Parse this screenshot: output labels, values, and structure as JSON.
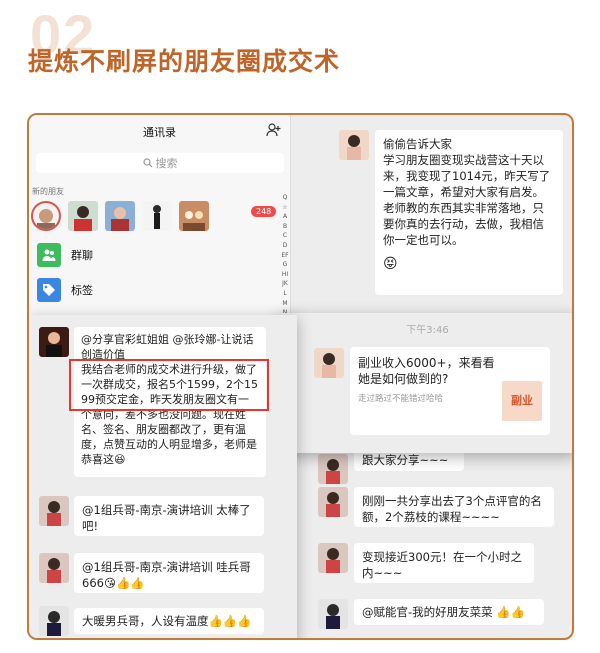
{
  "header": {
    "bg_number": "02",
    "title": "提炼不刷屏的朋友圈成交术"
  },
  "contacts": {
    "title": "通讯录",
    "search_placeholder": "搜索",
    "new_friends_label": "新的朋友",
    "new_friends_badge": "248",
    "menu": [
      {
        "label": "群聊",
        "color": "#3dbb5d"
      },
      {
        "label": "标签",
        "color": "#3b86e0"
      }
    ],
    "index_letters": "Q☆ABCDEFGHIJKLMNOPQRSTUVWXYZ#"
  },
  "chat_right": {
    "messages": [
      {
        "text": "偷偷告诉大家\n学习朋友圈变现实战营这十天以来，我变现了1014元，昨天写了一篇文章，希望对大家有启发。\n老师教的东西其实非常落地，只要你真的去行动，去做，我相信你一定也可以。",
        "emoji": "😝"
      },
      {
        "text": "跟大家分享~~~"
      },
      {
        "text": "刚刚一共分享出去了3个点评官的名额，2个荔枝的课程~~~~"
      },
      {
        "text": "变现接近300元！在一个小时之内~~~"
      },
      {
        "text": "@赋能官-我的好朋友菜菜",
        "emoji": "👍👍"
      }
    ],
    "time": "下午3:46",
    "link_card": {
      "title": "副业收入6000+，来看看她是如何做到的?",
      "source": "走过路过不能错过哈哈",
      "thumb_text": "副业"
    }
  },
  "group_chat": {
    "messages": [
      {
        "text": "@分享官彩虹姐姐 @张玲娜-让说话创造价值\n我结合老师的成交术进行升级，做了一次群成交，报名5个1599，2个1599预交定金，昨天发朋友圈文有一个意向，差不多也没问题。现在姓名、签名、朋友圈都改了，更有温度，点赞互动的人明显增多，老师是恭喜这",
        "emoji": "😆"
      },
      {
        "text": "@1组兵哥-南京-演讲培训 太棒了吧!"
      },
      {
        "text": "@1组兵哥-南京-演讲培训 哇兵哥666",
        "emoji": "😘👍👍"
      },
      {
        "text": "大暖男兵哥，人设有温度",
        "emoji": "👍👍👍"
      }
    ]
  }
}
